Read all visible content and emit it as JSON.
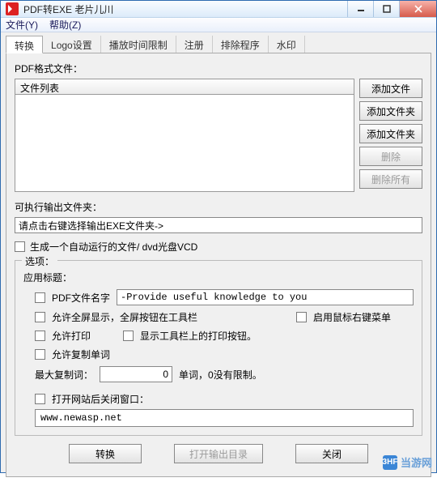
{
  "window": {
    "title": "PDF转EXE   老片儿川"
  },
  "menubar": {
    "file": "文件(Y)",
    "help": "帮助(Z)"
  },
  "tabs": [
    "转换",
    "Logo设置",
    "播放时间限制",
    "注册",
    "排除程序",
    "水印"
  ],
  "pdf_section_label": "PDF格式文件：",
  "file_list_header": "文件列表",
  "side_buttons": {
    "add_file": "添加文件",
    "add_folder1": "添加文件夹",
    "add_folder2": "添加文件夹",
    "delete": "删除",
    "delete_all": "删除所有"
  },
  "output_label": "可执行输出文件夹：",
  "output_value": "请点击右键选择输出EXE文件夹->",
  "autorun_label": "生成一个自动运行的文件/ dvd光盘VCD",
  "options": {
    "group_title": "选项：",
    "app_title_label": "应用标题：",
    "pdf_name_label": "PDF文件名字",
    "pdf_name_value": "-Provide useful knowledge to you",
    "fullscreen_label": "允许全屏显示，全屏按钮在工具栏",
    "rightclick_label": "启用鼠标右键菜单",
    "print_label": "允许打印",
    "show_print_label": "显示工具栏上的打印按钮。",
    "copy_label": "允许复制单词",
    "max_copy_label": "最大复制词：",
    "max_copy_value": "0",
    "max_copy_suffix": "单词，0没有限制。",
    "close_after_label": "打开网站后关闭窗口：",
    "url_value": "www.newasp.net"
  },
  "bottom": {
    "convert": "转换",
    "open_dir": "打开输出目录",
    "close": "关闭"
  },
  "watermark": {
    "prefix": "3HF",
    "text": "当游网"
  }
}
